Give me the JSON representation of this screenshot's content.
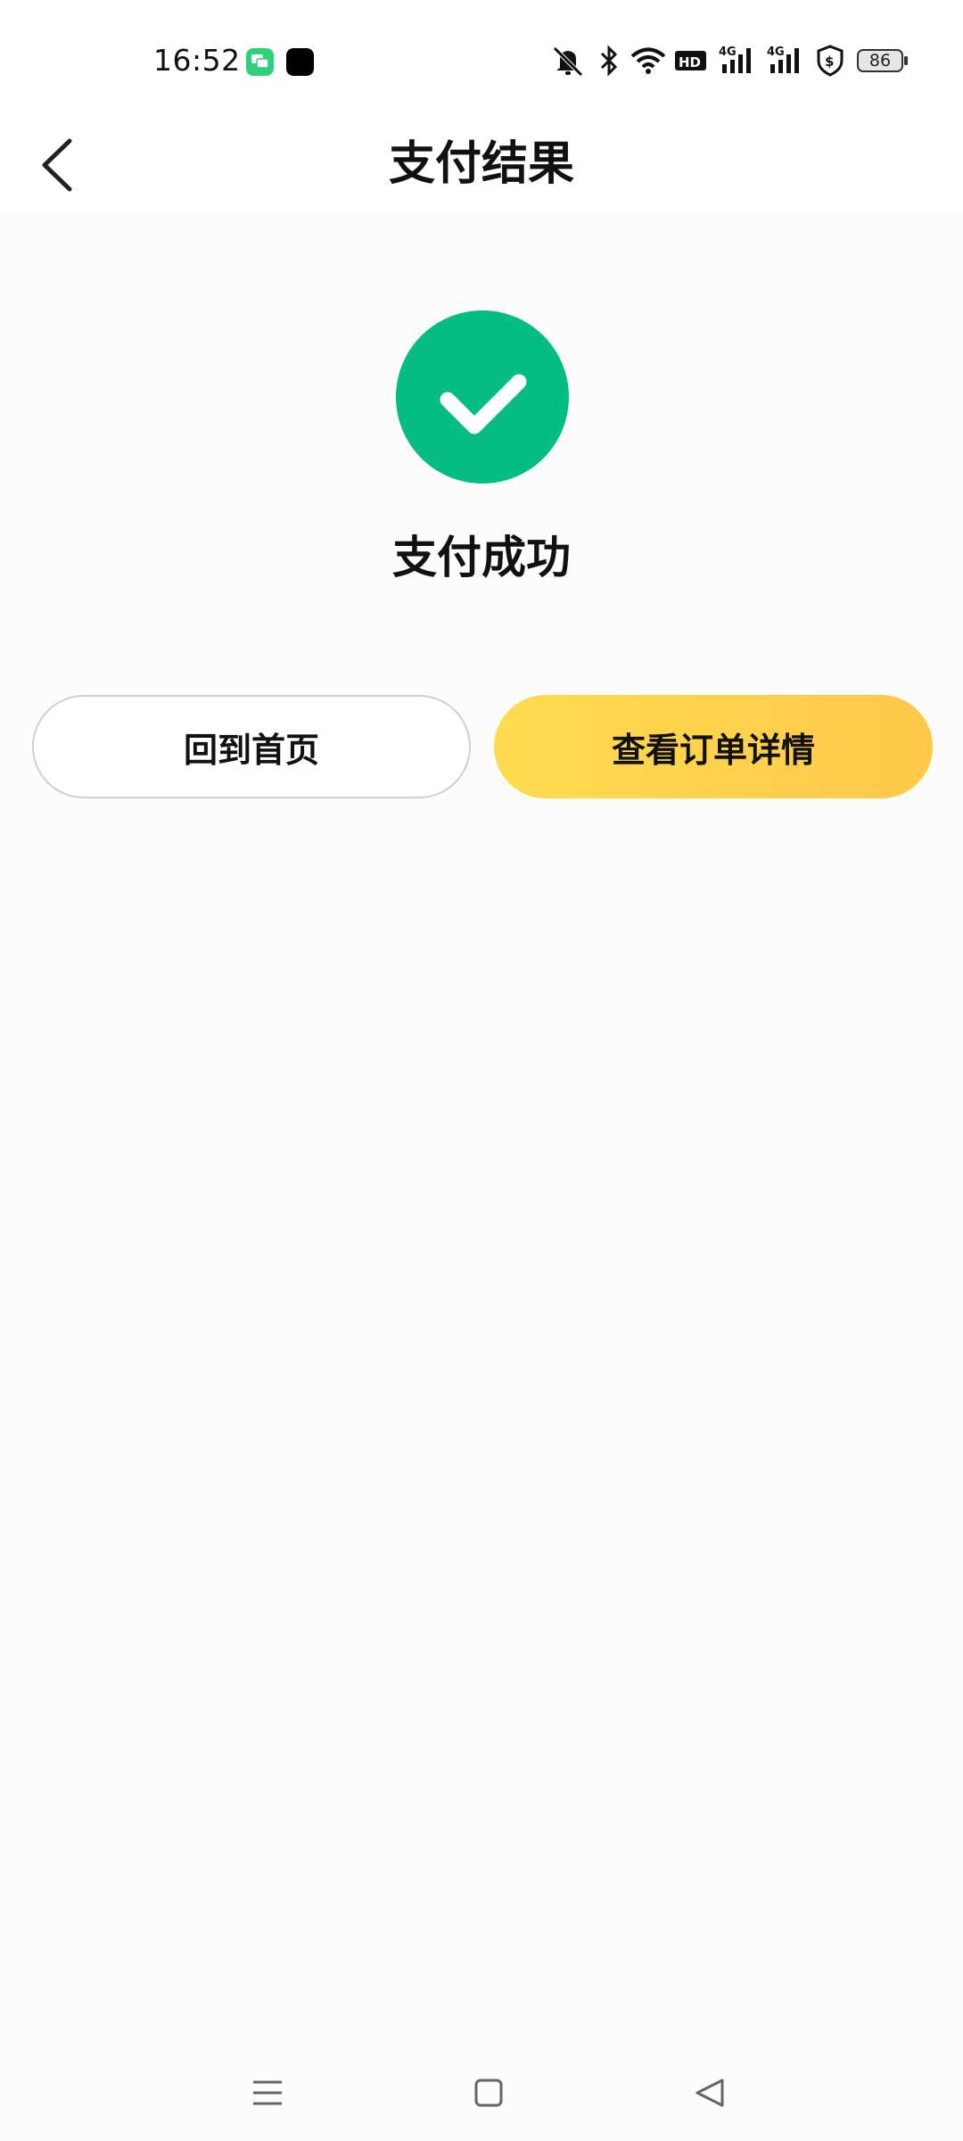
{
  "status_bar": {
    "time": "16:52",
    "battery_level": "86",
    "notification_icons": [
      "chat-app-icon",
      "black-app-icon"
    ],
    "system_icons": [
      "mute-icon",
      "bluetooth-icon",
      "wifi-icon",
      "hd-icon",
      "signal-4g-icon",
      "signal-4g-icon",
      "shield-dollar-icon",
      "battery-icon"
    ]
  },
  "header": {
    "title": "支付结果",
    "back_icon": "chevron-left-icon"
  },
  "result": {
    "status_text": "支付成功",
    "icon": "check-circle-icon",
    "icon_color": "#03bd82"
  },
  "actions": {
    "home_label": "回到首页",
    "order_label": "查看订单详情",
    "order_gradient": [
      "#ffdc4f",
      "#ffc84a"
    ]
  },
  "nav_bar": {
    "items": [
      "menu-icon",
      "home-square-icon",
      "back-triangle-icon"
    ]
  }
}
